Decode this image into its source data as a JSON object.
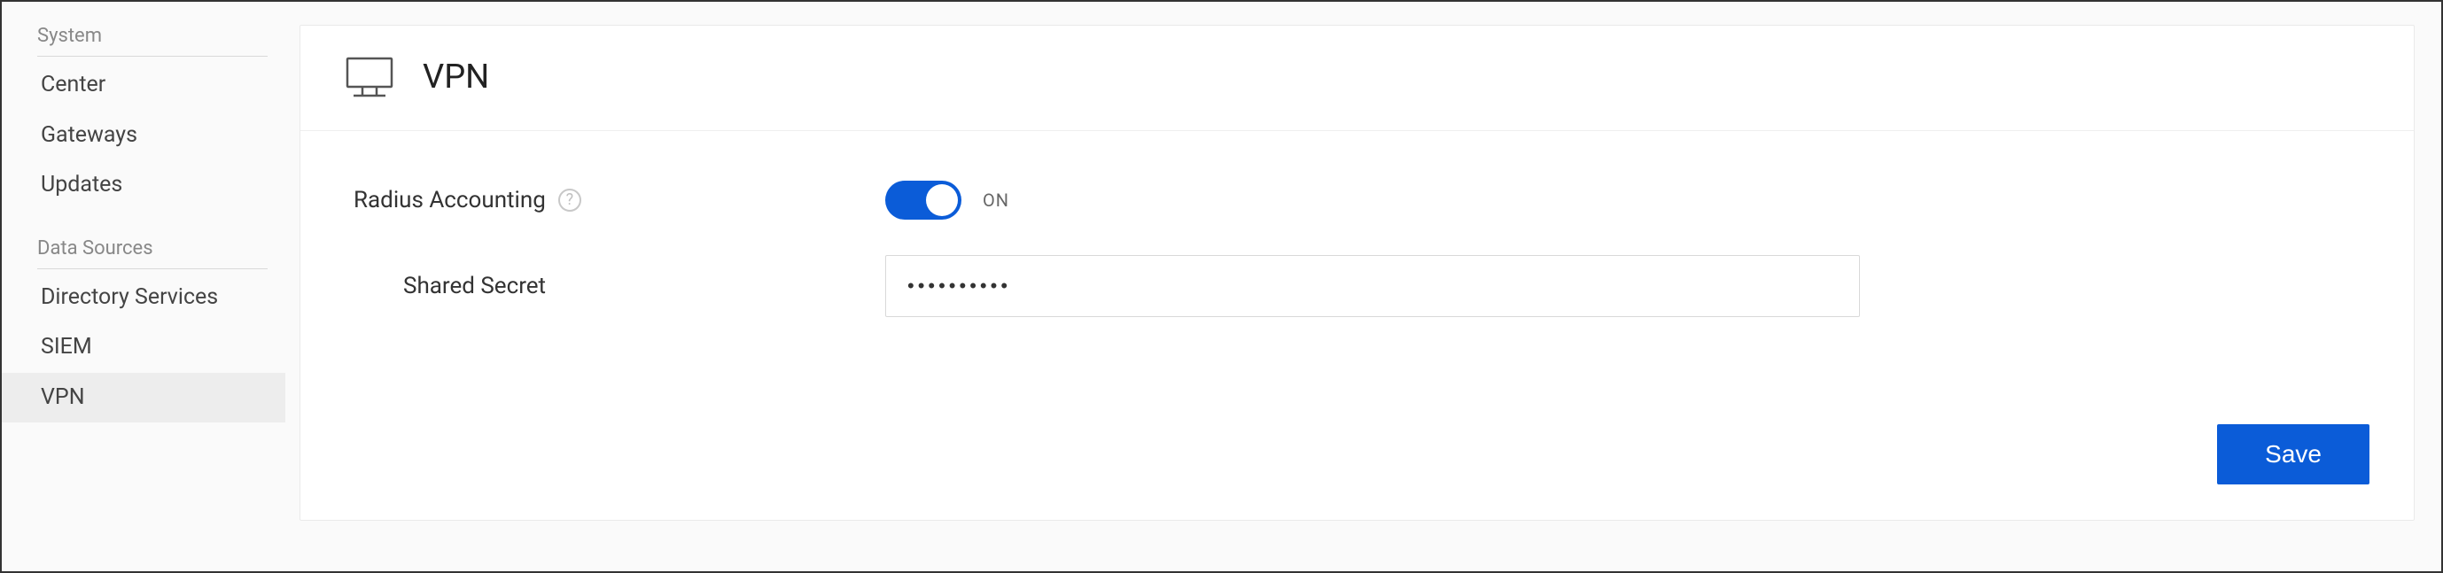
{
  "sidebar": {
    "sections": [
      {
        "header": "System",
        "items": [
          "Center",
          "Gateways",
          "Updates"
        ]
      },
      {
        "header": "Data Sources",
        "items": [
          "Directory Services",
          "SIEM",
          "VPN"
        ]
      }
    ],
    "active": "VPN"
  },
  "page": {
    "title": "VPN"
  },
  "form": {
    "radius_accounting_label": "Radius Accounting",
    "radius_accounting_on": true,
    "toggle_state_label": "ON",
    "shared_secret_label": "Shared Secret",
    "shared_secret_value": "••••••••••"
  },
  "actions": {
    "save_label": "Save"
  }
}
